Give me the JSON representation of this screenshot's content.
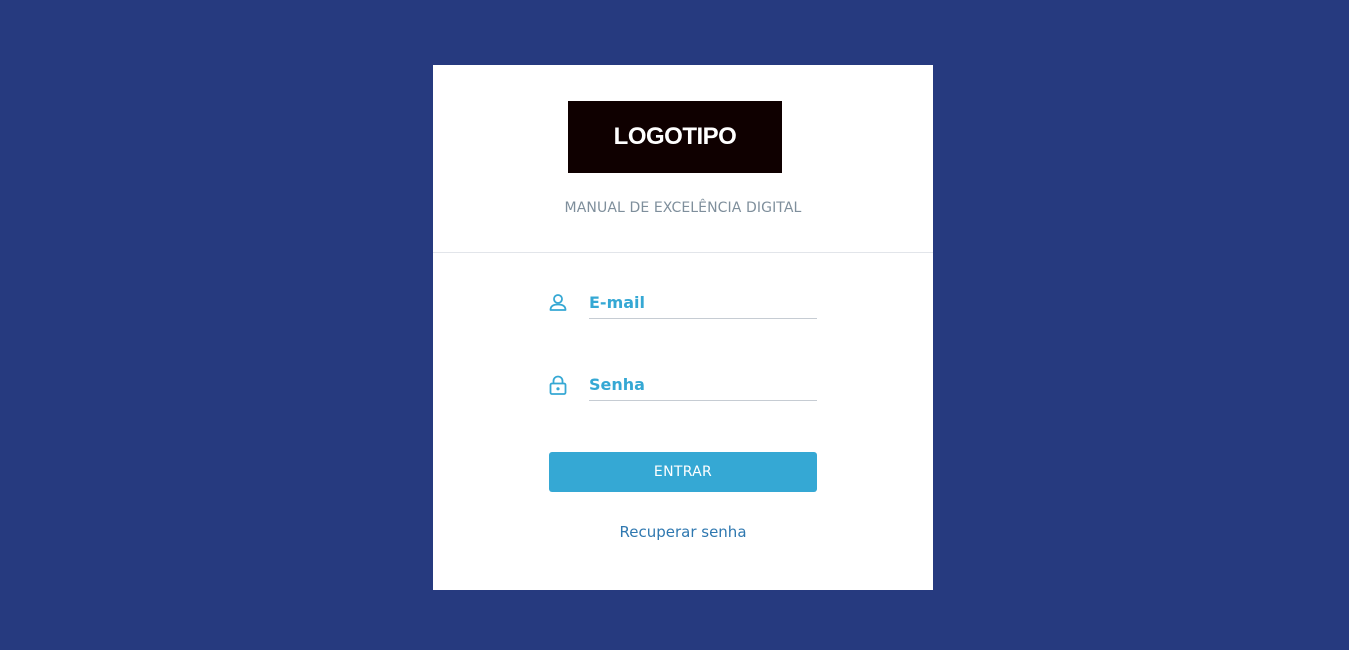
{
  "logo": {
    "text": "LOGOTIPO"
  },
  "header": {
    "subtitle": "MANUAL DE EXCELÊNCIA DIGITAL"
  },
  "form": {
    "email": {
      "placeholder": "E-mail",
      "value": "",
      "icon": "user-icon"
    },
    "password": {
      "placeholder": "Senha",
      "value": "",
      "icon": "lock-icon"
    },
    "submit_label": "ENTRAR",
    "recover_label": "Recuperar senha"
  },
  "colors": {
    "background": "#263a7f",
    "card": "#ffffff",
    "accent": "#35a8d4",
    "link": "#2f78b0",
    "subtitle": "#7f8f9c",
    "logo_bg": "#0f0000"
  }
}
